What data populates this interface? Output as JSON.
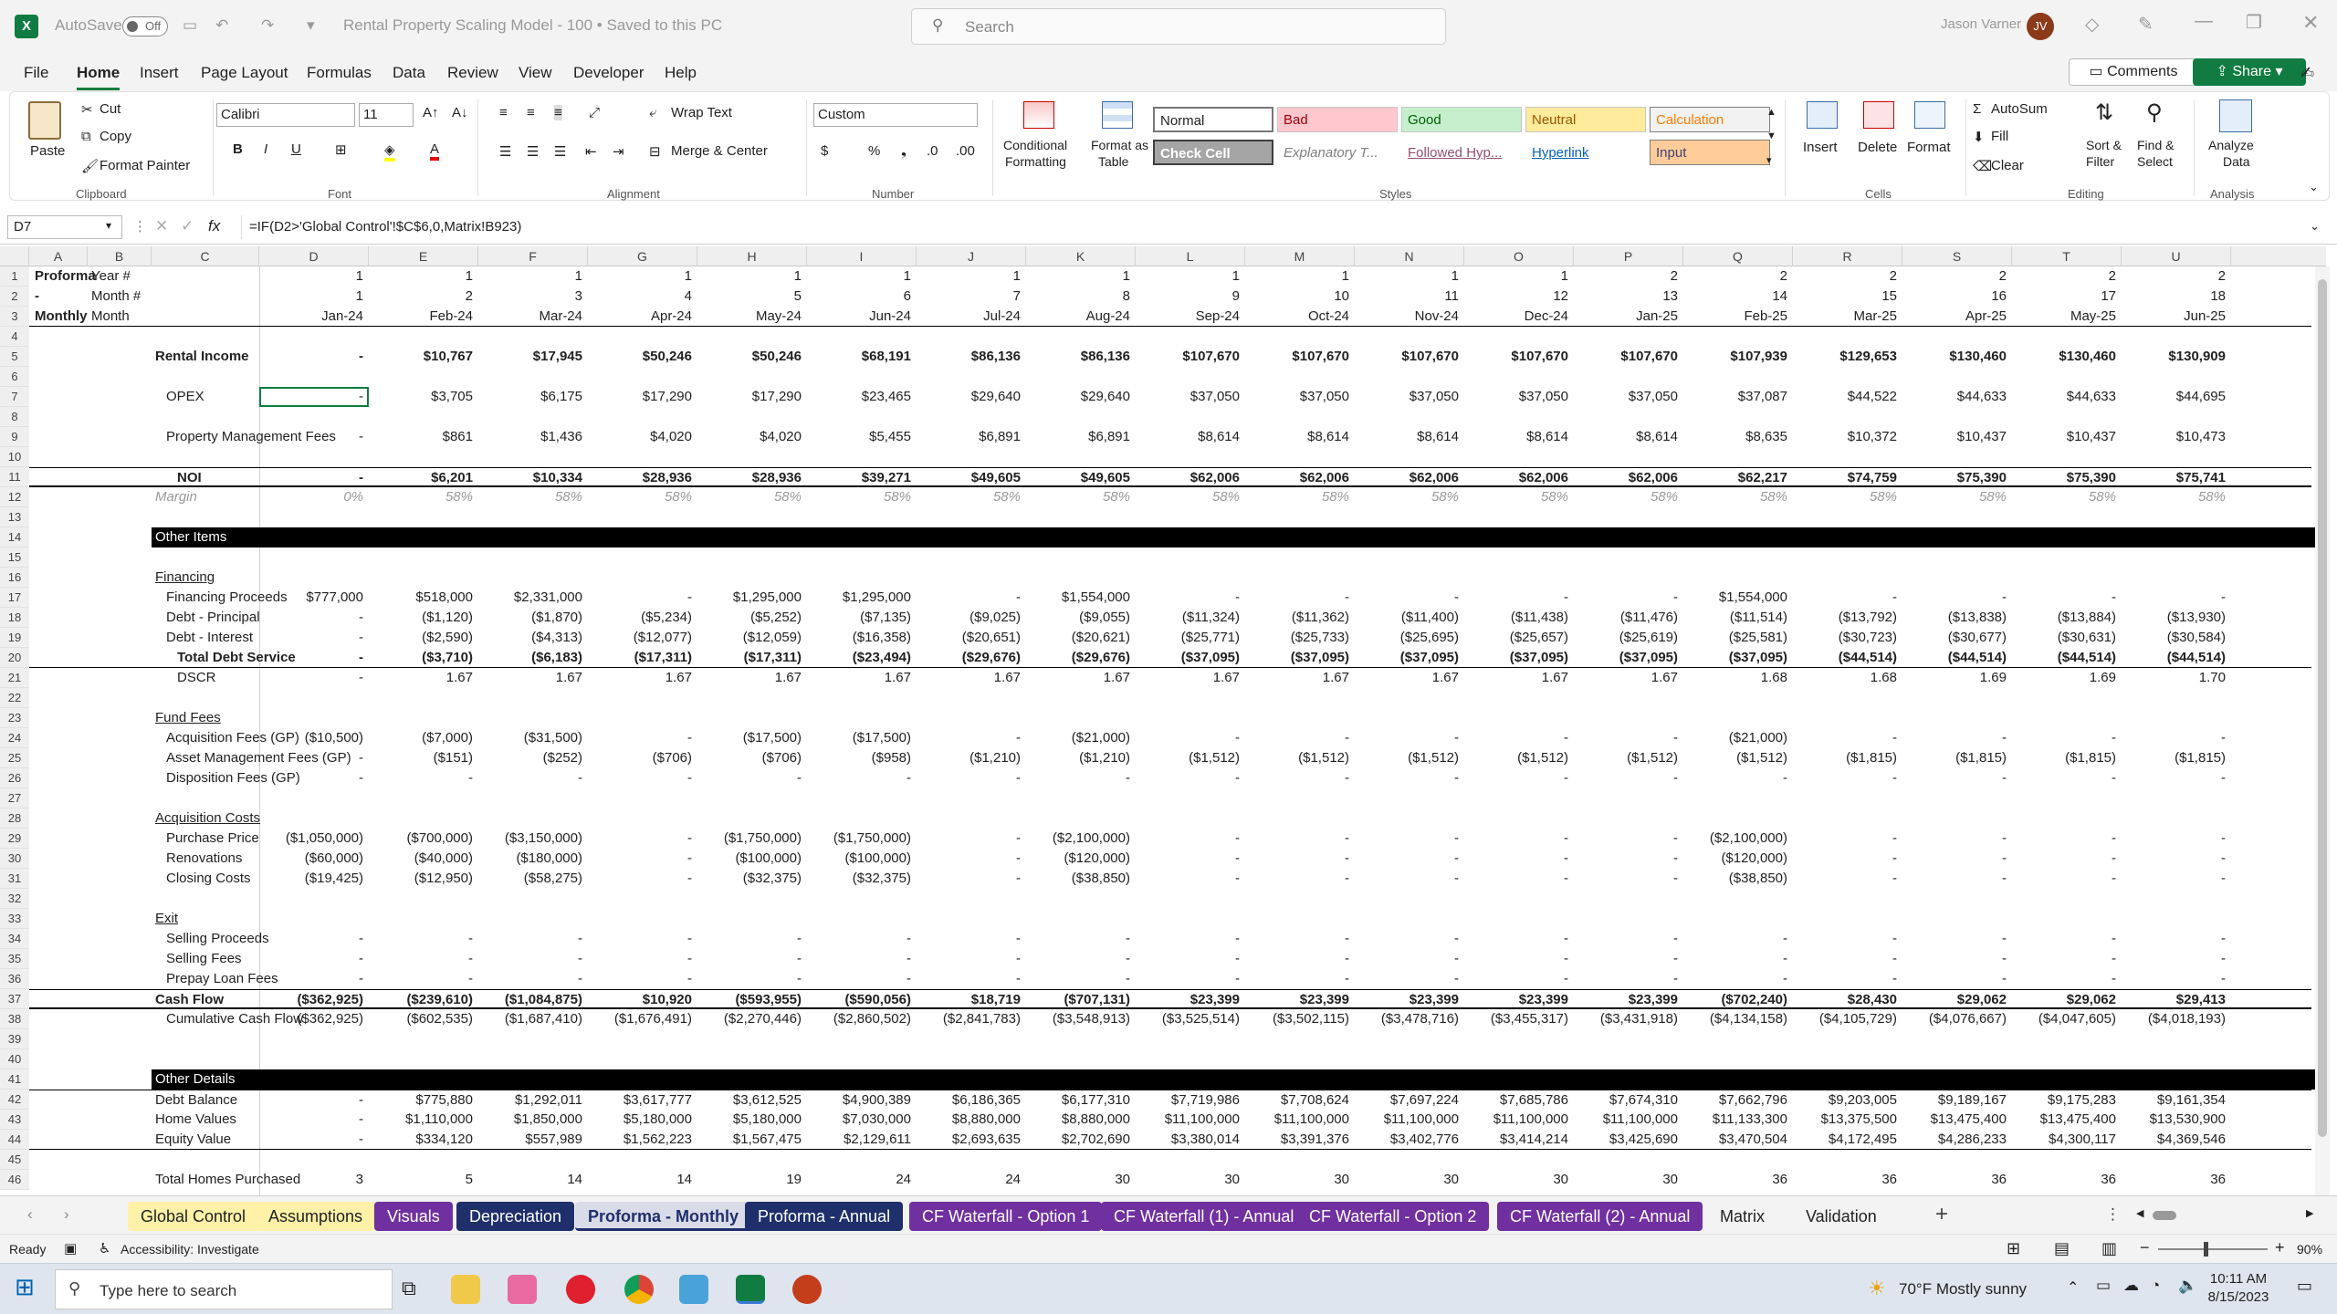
{
  "app": {
    "autosave": "AutoSave",
    "autosave_state": "Off",
    "doc_title": "Rental Property Scaling Model - 100 • Saved to this PC",
    "search_placeholder": "Search",
    "user": "Jason Varner",
    "user_initials": "JV"
  },
  "menu": [
    "File",
    "Home",
    "Insert",
    "Page Layout",
    "Formulas",
    "Data",
    "Review",
    "View",
    "Developer",
    "Help"
  ],
  "header_buttons": {
    "comments": "Comments",
    "share": "Share"
  },
  "ribbon": {
    "clipboard": {
      "paste": "Paste",
      "cut": "Cut",
      "copy": "Copy",
      "format_painter": "Format Painter",
      "label": "Clipboard"
    },
    "font": {
      "name": "Calibri",
      "size": "11",
      "label": "Font"
    },
    "alignment": {
      "wrap": "Wrap Text",
      "merge": "Merge & Center",
      "label": "Alignment"
    },
    "number": {
      "format": "Custom",
      "label": "Number"
    },
    "styles": {
      "conditional": "Conditional",
      "conditional2": "Formatting",
      "format_table": "Format as",
      "format_table2": "Table",
      "label": "Styles",
      "cells": [
        {
          "name": "Normal",
          "bg": "#ffffff",
          "fg": "#000000"
        },
        {
          "name": "Bad",
          "bg": "#ffc7ce",
          "fg": "#9c0006"
        },
        {
          "name": "Good",
          "bg": "#c6efce",
          "fg": "#006100"
        },
        {
          "name": "Neutral",
          "bg": "#ffeb9c",
          "fg": "#9c5700"
        },
        {
          "name": "Calculation",
          "bg": "#f2f2f2",
          "fg": "#fa7d00"
        },
        {
          "name": "Check Cell",
          "bg": "#a5a5a5",
          "fg": "#ffffff"
        },
        {
          "name": "Explanatory T...",
          "bg": "#ffffff",
          "fg": "#7f7f7f"
        },
        {
          "name": "Followed Hyp...",
          "bg": "#ffffff",
          "fg": "#954f72"
        },
        {
          "name": "Hyperlink",
          "bg": "#ffffff",
          "fg": "#0563c1"
        },
        {
          "name": "Input",
          "bg": "#ffcc99",
          "fg": "#3f3f76"
        }
      ]
    },
    "cells": {
      "insert": "Insert",
      "delete": "Delete",
      "format": "Format",
      "label": "Cells"
    },
    "editing": {
      "autosum": "AutoSum",
      "fill": "Fill",
      "clear": "Clear",
      "sort": "Sort &",
      "sort2": "Filter",
      "find": "Find &",
      "find2": "Select",
      "label": "Editing"
    },
    "analysis": {
      "analyze": "Analyze",
      "analyze2": "Data",
      "label": "Analysis"
    }
  },
  "formula_bar": {
    "name_box": "D7",
    "formula": "=IF(D2>'Global Control'!$C$6,0,Matrix!B923)"
  },
  "columns": [
    "A",
    "B",
    "C",
    "D",
    "E",
    "F",
    "G",
    "H",
    "I",
    "J",
    "K",
    "L",
    "M",
    "N",
    "O",
    "P",
    "Q",
    "R",
    "S",
    "T",
    "U"
  ],
  "rows": [
    {
      "n": 1,
      "a": "Proforma - Monthly",
      "c": "Year #",
      "v": [
        "1",
        "1",
        "1",
        "1",
        "1",
        "1",
        "1",
        "1",
        "1",
        "1",
        "1",
        "1",
        "2",
        "2",
        "2",
        "2",
        "2",
        "2"
      ]
    },
    {
      "n": 2,
      "c": "Month #",
      "v": [
        "1",
        "2",
        "3",
        "4",
        "5",
        "6",
        "7",
        "8",
        "9",
        "10",
        "11",
        "12",
        "13",
        "14",
        "15",
        "16",
        "17",
        "18"
      ]
    },
    {
      "n": 3,
      "c": "Month",
      "v": [
        "Jan-24",
        "Feb-24",
        "Mar-24",
        "Apr-24",
        "May-24",
        "Jun-24",
        "Jul-24",
        "Aug-24",
        "Sep-24",
        "Oct-24",
        "Nov-24",
        "Dec-24",
        "Jan-25",
        "Feb-25",
        "Mar-25",
        "Apr-25",
        "May-25",
        "Jun-25"
      ]
    },
    {
      "n": 4
    },
    {
      "n": 5,
      "c": "Rental Income",
      "bold": true,
      "v": [
        "-",
        "$10,767",
        "$17,945",
        "$50,246",
        "$50,246",
        "$68,191",
        "$86,136",
        "$86,136",
        "$107,670",
        "$107,670",
        "$107,670",
        "$107,670",
        "$107,670",
        "$107,939",
        "$129,653",
        "$130,460",
        "$130,460",
        "$130,909"
      ]
    },
    {
      "n": 6
    },
    {
      "n": 7,
      "c": "OPEX",
      "ind": 1,
      "v": [
        "-",
        "$3,705",
        "$6,175",
        "$17,290",
        "$17,290",
        "$23,465",
        "$29,640",
        "$29,640",
        "$37,050",
        "$37,050",
        "$37,050",
        "$37,050",
        "$37,050",
        "$37,087",
        "$44,522",
        "$44,633",
        "$44,633",
        "$44,695"
      ]
    },
    {
      "n": 8
    },
    {
      "n": 9,
      "c": "Property Management Fees",
      "ind": 1,
      "v": [
        "-",
        "$861",
        "$1,436",
        "$4,020",
        "$4,020",
        "$5,455",
        "$6,891",
        "$6,891",
        "$8,614",
        "$8,614",
        "$8,614",
        "$8,614",
        "$8,614",
        "$8,635",
        "$10,372",
        "$10,437",
        "$10,437",
        "$10,473"
      ]
    },
    {
      "n": 10
    },
    {
      "n": 11,
      "c": "NOI",
      "ind": 2,
      "bold": true,
      "v": [
        "-",
        "$6,201",
        "$10,334",
        "$28,936",
        "$28,936",
        "$39,271",
        "$49,605",
        "$49,605",
        "$62,006",
        "$62,006",
        "$62,006",
        "$62,006",
        "$62,006",
        "$62,217",
        "$74,759",
        "$75,390",
        "$75,390",
        "$75,741"
      ]
    },
    {
      "n": 12,
      "c": "Margin",
      "italic": true,
      "v": [
        "0%",
        "58%",
        "58%",
        "58%",
        "58%",
        "58%",
        "58%",
        "58%",
        "58%",
        "58%",
        "58%",
        "58%",
        "58%",
        "58%",
        "58%",
        "58%",
        "58%",
        "58%"
      ]
    },
    {
      "n": 13
    },
    {
      "n": 14,
      "c": "Other Items",
      "band": true
    },
    {
      "n": 15
    },
    {
      "n": 16,
      "c": "Financing",
      "underline": true
    },
    {
      "n": 17,
      "c": "Financing Proceeds",
      "ind": 1,
      "v": [
        "$777,000",
        "$518,000",
        "$2,331,000",
        "-",
        "$1,295,000",
        "$1,295,000",
        "-",
        "$1,554,000",
        "-",
        "-",
        "-",
        "-",
        "-",
        "$1,554,000",
        "-",
        "-",
        "-",
        "-"
      ]
    },
    {
      "n": 18,
      "c": "Debt - Principal",
      "ind": 1,
      "v": [
        "-",
        "($1,120)",
        "($1,870)",
        "($5,234)",
        "($5,252)",
        "($7,135)",
        "($9,025)",
        "($9,055)",
        "($11,324)",
        "($11,362)",
        "($11,400)",
        "($11,438)",
        "($11,476)",
        "($11,514)",
        "($13,792)",
        "($13,838)",
        "($13,884)",
        "($13,930)"
      ]
    },
    {
      "n": 19,
      "c": "Debt - Interest",
      "ind": 1,
      "v": [
        "-",
        "($2,590)",
        "($4,313)",
        "($12,077)",
        "($12,059)",
        "($16,358)",
        "($20,651)",
        "($20,621)",
        "($25,771)",
        "($25,733)",
        "($25,695)",
        "($25,657)",
        "($25,619)",
        "($25,581)",
        "($30,723)",
        "($30,677)",
        "($30,631)",
        "($30,584)"
      ]
    },
    {
      "n": 20,
      "c": "Total Debt Service",
      "ind": 2,
      "bold": true,
      "v": [
        "-",
        "($3,710)",
        "($6,183)",
        "($17,311)",
        "($17,311)",
        "($23,494)",
        "($29,676)",
        "($29,676)",
        "($37,095)",
        "($37,095)",
        "($37,095)",
        "($37,095)",
        "($37,095)",
        "($37,095)",
        "($44,514)",
        "($44,514)",
        "($44,514)",
        "($44,514)"
      ]
    },
    {
      "n": 21,
      "c": "DSCR",
      "ind": 2,
      "v": [
        "-",
        "1.67",
        "1.67",
        "1.67",
        "1.67",
        "1.67",
        "1.67",
        "1.67",
        "1.67",
        "1.67",
        "1.67",
        "1.67",
        "1.67",
        "1.68",
        "1.68",
        "1.69",
        "1.69",
        "1.70"
      ]
    },
    {
      "n": 22
    },
    {
      "n": 23,
      "c": "Fund Fees",
      "underline": true
    },
    {
      "n": 24,
      "c": "Acquisition Fees (GP)",
      "ind": 1,
      "v": [
        "($10,500)",
        "($7,000)",
        "($31,500)",
        "-",
        "($17,500)",
        "($17,500)",
        "-",
        "($21,000)",
        "-",
        "-",
        "-",
        "-",
        "-",
        "($21,000)",
        "-",
        "-",
        "-",
        "-"
      ]
    },
    {
      "n": 25,
      "c": "Asset Management Fees (GP)",
      "ind": 1,
      "v": [
        "-",
        "($151)",
        "($252)",
        "($706)",
        "($706)",
        "($958)",
        "($1,210)",
        "($1,210)",
        "($1,512)",
        "($1,512)",
        "($1,512)",
        "($1,512)",
        "($1,512)",
        "($1,512)",
        "($1,815)",
        "($1,815)",
        "($1,815)",
        "($1,815)"
      ]
    },
    {
      "n": 26,
      "c": "Disposition Fees (GP)",
      "ind": 1,
      "v": [
        "-",
        "-",
        "-",
        "-",
        "-",
        "-",
        "-",
        "-",
        "-",
        "-",
        "-",
        "-",
        "-",
        "-",
        "-",
        "-",
        "-",
        "-"
      ]
    },
    {
      "n": 27
    },
    {
      "n": 28,
      "c": "Acquisition Costs",
      "underline": true
    },
    {
      "n": 29,
      "c": "Purchase Price",
      "ind": 1,
      "v": [
        "($1,050,000)",
        "($700,000)",
        "($3,150,000)",
        "-",
        "($1,750,000)",
        "($1,750,000)",
        "-",
        "($2,100,000)",
        "-",
        "-",
        "-",
        "-",
        "-",
        "($2,100,000)",
        "-",
        "-",
        "-",
        "-"
      ]
    },
    {
      "n": 30,
      "c": "Renovations",
      "ind": 1,
      "v": [
        "($60,000)",
        "($40,000)",
        "($180,000)",
        "-",
        "($100,000)",
        "($100,000)",
        "-",
        "($120,000)",
        "-",
        "-",
        "-",
        "-",
        "-",
        "($120,000)",
        "-",
        "-",
        "-",
        "-"
      ]
    },
    {
      "n": 31,
      "c": "Closing Costs",
      "ind": 1,
      "v": [
        "($19,425)",
        "($12,950)",
        "($58,275)",
        "-",
        "($32,375)",
        "($32,375)",
        "-",
        "($38,850)",
        "-",
        "-",
        "-",
        "-",
        "-",
        "($38,850)",
        "-",
        "-",
        "-",
        "-"
      ]
    },
    {
      "n": 32
    },
    {
      "n": 33,
      "c": "Exit",
      "underline": true
    },
    {
      "n": 34,
      "c": "Selling Proceeds",
      "ind": 1,
      "v": [
        "-",
        "-",
        "-",
        "-",
        "-",
        "-",
        "-",
        "-",
        "-",
        "-",
        "-",
        "-",
        "-",
        "-",
        "-",
        "-",
        "-",
        "-"
      ]
    },
    {
      "n": 35,
      "c": "Selling Fees",
      "ind": 1,
      "v": [
        "-",
        "-",
        "-",
        "-",
        "-",
        "-",
        "-",
        "-",
        "-",
        "-",
        "-",
        "-",
        "-",
        "-",
        "-",
        "-",
        "-",
        "-"
      ]
    },
    {
      "n": 36,
      "c": "Prepay Loan Fees",
      "ind": 1,
      "v": [
        "-",
        "-",
        "-",
        "-",
        "-",
        "-",
        "-",
        "-",
        "-",
        "-",
        "-",
        "-",
        "-",
        "-",
        "-",
        "-",
        "-",
        "-"
      ]
    },
    {
      "n": 37,
      "c": "Cash Flow",
      "bold": true,
      "v": [
        "($362,925)",
        "($239,610)",
        "($1,084,875)",
        "$10,920",
        "($593,955)",
        "($590,056)",
        "$18,719",
        "($707,131)",
        "$23,399",
        "$23,399",
        "$23,399",
        "$23,399",
        "$23,399",
        "($702,240)",
        "$28,430",
        "$29,062",
        "$29,062",
        "$29,413"
      ]
    },
    {
      "n": 38,
      "c": "Cumulative Cash Flow",
      "ind": 1,
      "v": [
        "($362,925)",
        "($602,535)",
        "($1,687,410)",
        "($1,676,491)",
        "($2,270,446)",
        "($2,860,502)",
        "($2,841,783)",
        "($3,548,913)",
        "($3,525,514)",
        "($3,502,115)",
        "($3,478,716)",
        "($3,455,317)",
        "($3,431,918)",
        "($4,134,158)",
        "($4,105,729)",
        "($4,076,667)",
        "($4,047,605)",
        "($4,018,193)"
      ]
    },
    {
      "n": 39
    },
    {
      "n": 40
    },
    {
      "n": 41,
      "c": "Other Details",
      "band": true
    },
    {
      "n": 42,
      "c": "Debt Balance",
      "v": [
        "-",
        "$775,880",
        "$1,292,011",
        "$3,617,777",
        "$3,612,525",
        "$4,900,389",
        "$6,186,365",
        "$6,177,310",
        "$7,719,986",
        "$7,708,624",
        "$7,697,224",
        "$7,685,786",
        "$7,674,310",
        "$7,662,796",
        "$9,203,005",
        "$9,189,167",
        "$9,175,283",
        "$9,161,354"
      ]
    },
    {
      "n": 43,
      "c": "Home Values",
      "v": [
        "-",
        "$1,110,000",
        "$1,850,000",
        "$5,180,000",
        "$5,180,000",
        "$7,030,000",
        "$8,880,000",
        "$8,880,000",
        "$11,100,000",
        "$11,100,000",
        "$11,100,000",
        "$11,100,000",
        "$11,100,000",
        "$11,133,300",
        "$13,375,500",
        "$13,475,400",
        "$13,475,400",
        "$13,530,900"
      ]
    },
    {
      "n": 44,
      "c": "Equity Value",
      "v": [
        "-",
        "$334,120",
        "$557,989",
        "$1,562,223",
        "$1,567,475",
        "$2,129,611",
        "$2,693,635",
        "$2,702,690",
        "$3,380,014",
        "$3,391,376",
        "$3,402,776",
        "$3,414,214",
        "$3,425,690",
        "$3,470,504",
        "$4,172,495",
        "$4,286,233",
        "$4,300,117",
        "$4,369,546"
      ]
    },
    {
      "n": 45
    },
    {
      "n": 46,
      "c": "Total Homes Purchased",
      "v": [
        "3",
        "5",
        "14",
        "14",
        "19",
        "24",
        "24",
        "30",
        "30",
        "30",
        "30",
        "30",
        "30",
        "36",
        "36",
        "36",
        "36",
        "36"
      ]
    }
  ],
  "sheet_tabs": [
    {
      "name": "Global Control",
      "bg": "#fff2a8",
      "fg": "#222"
    },
    {
      "name": "Assumptions",
      "bg": "#fff2a8",
      "fg": "#222"
    },
    {
      "name": "Visuals",
      "bg": "#7030a0",
      "fg": "#fff"
    },
    {
      "name": "Depreciation",
      "bg": "#1f2f6b",
      "fg": "#fff"
    },
    {
      "name": "Proforma - Monthly",
      "bg": "#d9dbe8",
      "fg": "#1f2f6b",
      "active": true
    },
    {
      "name": "Proforma - Annual",
      "bg": "#1f2f6b",
      "fg": "#fff"
    },
    {
      "name": "CF Waterfall - Option 1",
      "bg": "#7030a0",
      "fg": "#fff"
    },
    {
      "name": "CF Waterfall (1) - Annual",
      "bg": "#7030a0",
      "fg": "#fff"
    },
    {
      "name": "CF Waterfall - Option 2",
      "bg": "#7030a0",
      "fg": "#fff"
    },
    {
      "name": "CF Waterfall (2) - Annual",
      "bg": "#7030a0",
      "fg": "#fff"
    },
    {
      "name": "Matrix",
      "bg": "#f3f3f3",
      "fg": "#222"
    },
    {
      "name": "Validation",
      "bg": "#f3f3f3",
      "fg": "#222"
    }
  ],
  "status": {
    "ready": "Ready",
    "accessibility": "Accessibility: Investigate",
    "zoom": "90%"
  },
  "taskbar": {
    "search_placeholder": "Type here to search",
    "weather": "70°F  Mostly sunny",
    "time": "10:11 AM",
    "date": "8/15/2023"
  }
}
